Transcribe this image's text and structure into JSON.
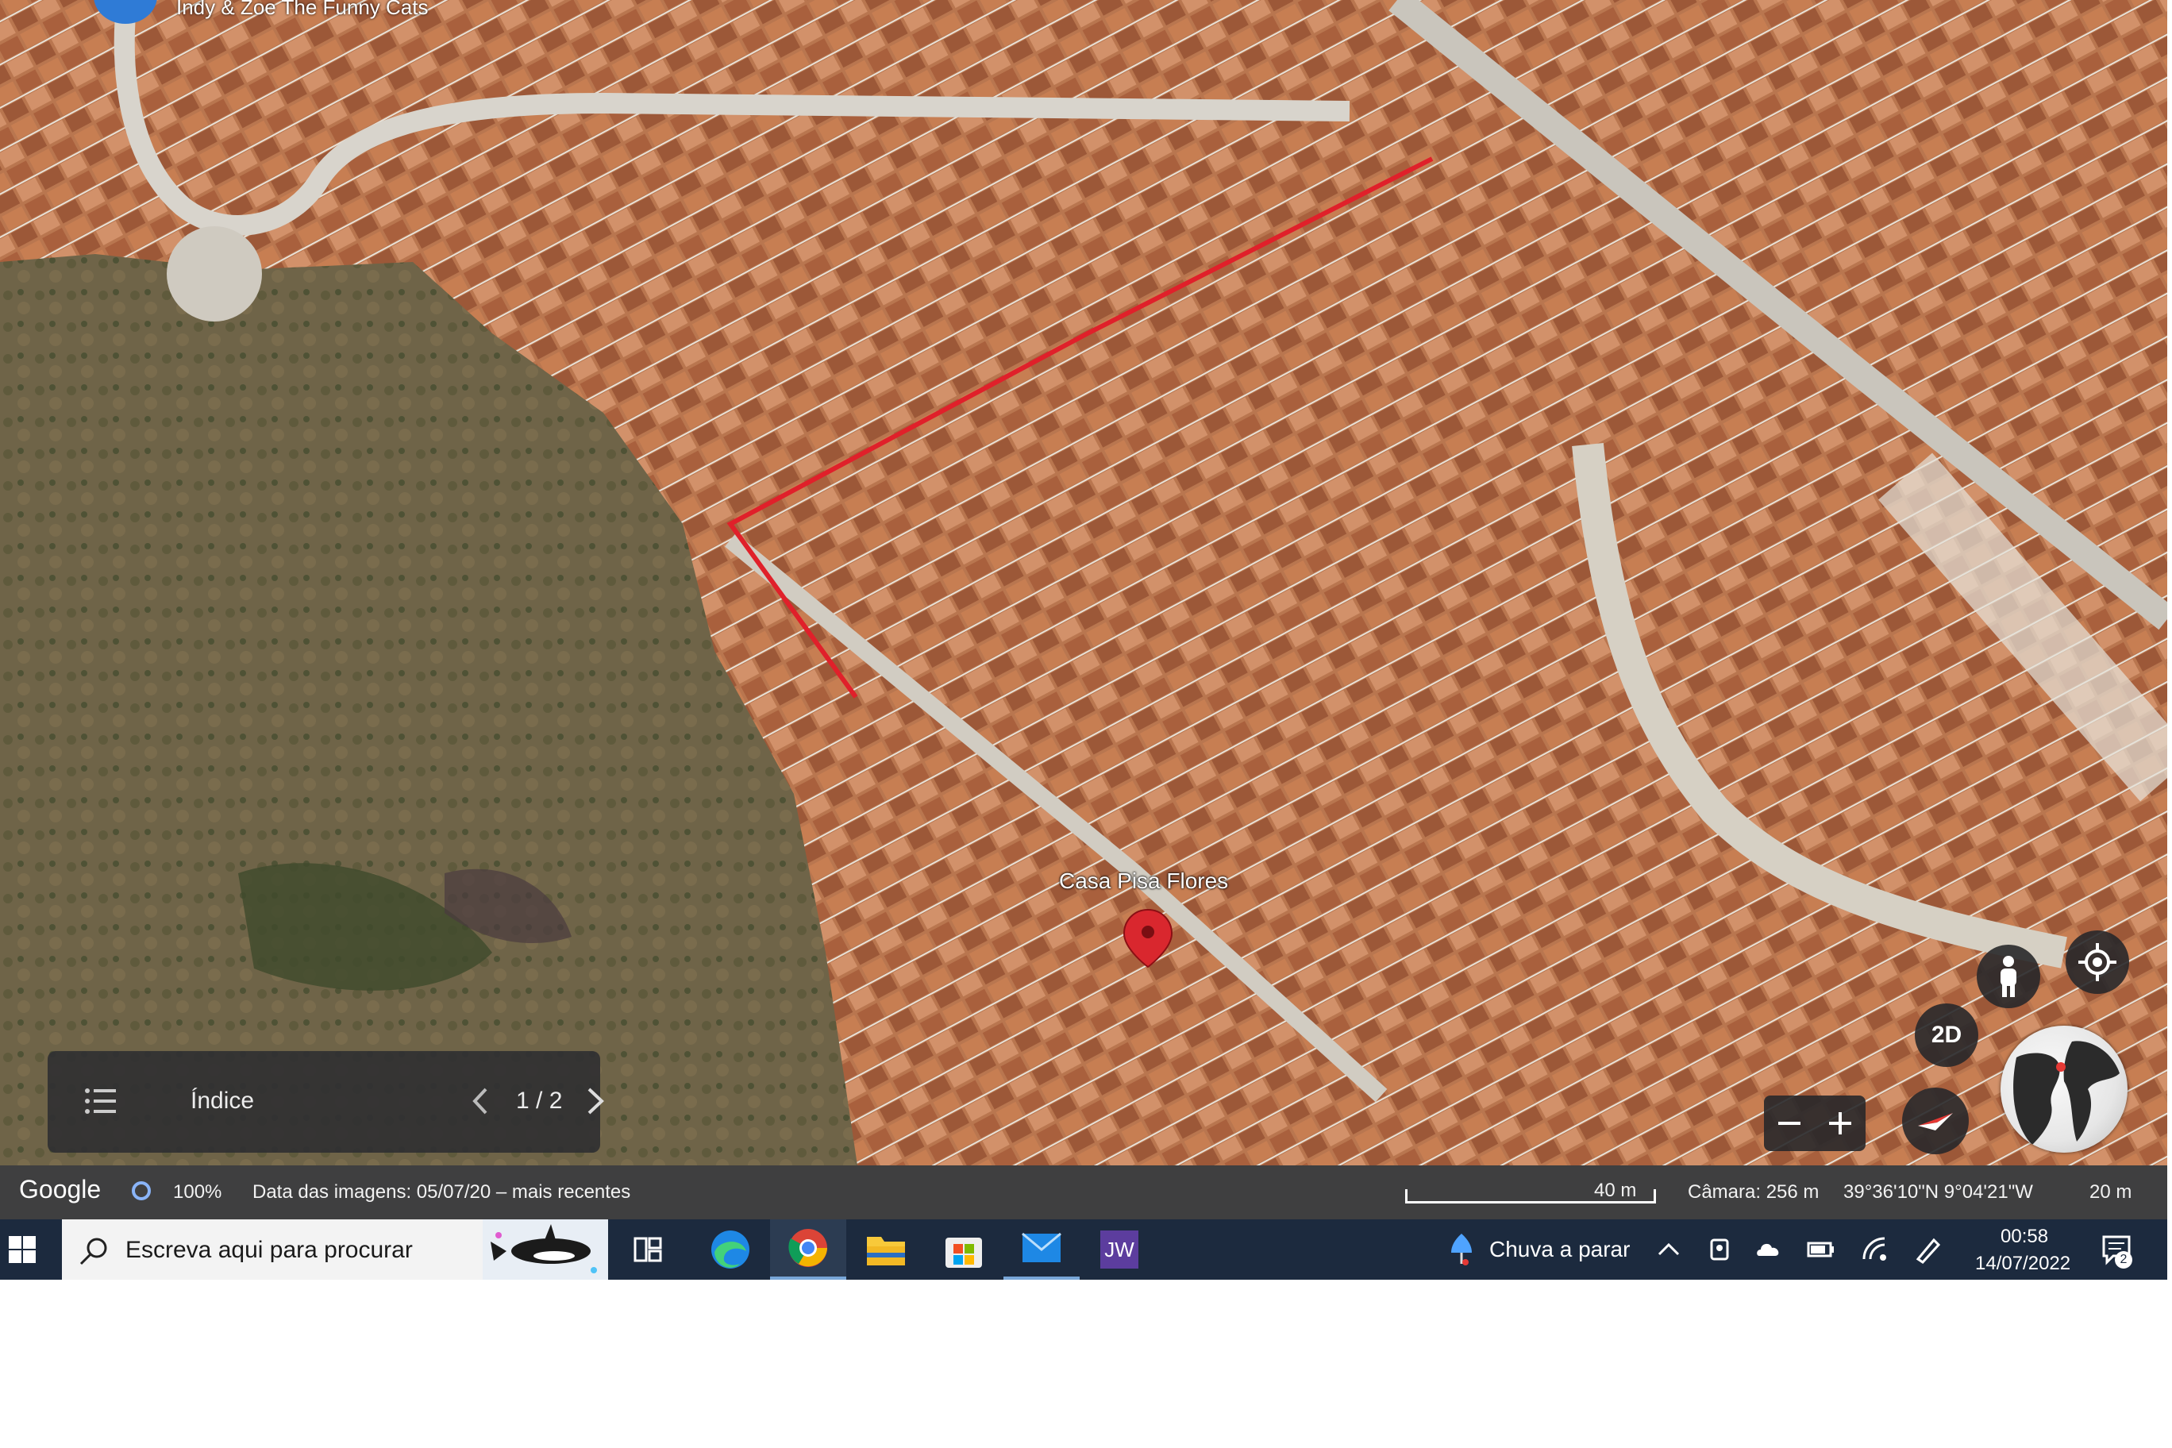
{
  "map": {
    "layer_label": "Indy & Zoe The Funny Cats",
    "placemark_label": "Casa Pisa Flores",
    "path_color": "#e0202a",
    "pin_color": "#d9272e"
  },
  "index_panel": {
    "title": "Índice",
    "page": "1 / 2",
    "list_icon": "list-icon",
    "prev_icon": "chevron-left-icon",
    "next_icon": "chevron-right-icon"
  },
  "controls": {
    "view_toggle": "2D",
    "pegman_icon": "pegman-icon",
    "locate_icon": "my-location-icon",
    "compass_icon": "compass-icon",
    "zoom_out_icon": "minus-icon",
    "zoom_in_icon": "plus-icon",
    "globe_icon": "globe-icon"
  },
  "status_bar": {
    "brand": "Google",
    "load_percent": "100%",
    "imagery_date": "Data das imagens: 05/07/20 – mais recentes",
    "scale": "40 m",
    "camera": "Câmara: 256 m",
    "coordinates": "39°36'10\"N 9°04'21\"W",
    "altitude": "20 m"
  },
  "taskbar": {
    "search_placeholder": "Escreva aqui para procurar",
    "apps": [
      {
        "name": "Task View",
        "icon": "task-view-icon"
      },
      {
        "name": "Microsoft Edge",
        "icon": "edge-icon"
      },
      {
        "name": "Google Chrome",
        "icon": "chrome-icon",
        "active": true
      },
      {
        "name": "File Explorer",
        "icon": "folder-icon"
      },
      {
        "name": "Microsoft Store",
        "icon": "store-icon"
      },
      {
        "name": "Mail",
        "icon": "mail-icon"
      },
      {
        "name": "JW",
        "label": "JW",
        "icon": "jw-icon"
      }
    ],
    "weather": "Chuva a parar",
    "time": "00:58",
    "date": "14/07/2022",
    "notification_count": "2"
  }
}
